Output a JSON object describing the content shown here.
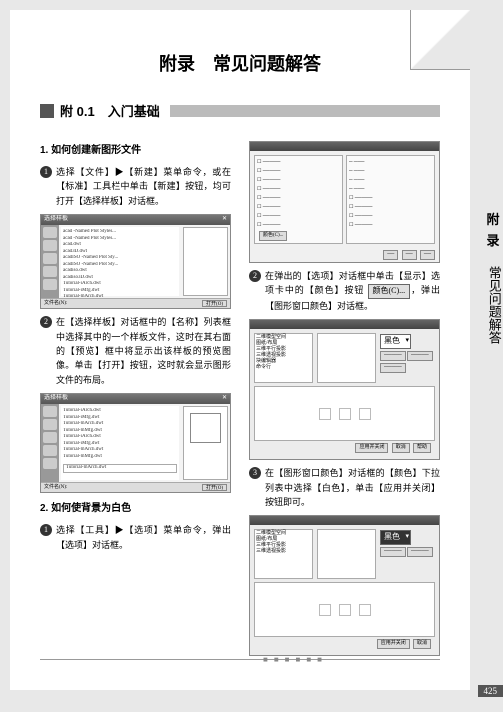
{
  "title": "附录　常见问题解答",
  "section": {
    "num": "附 0.1",
    "name": "入门基础"
  },
  "sidetab": {
    "l1": "附录",
    "l2": "常见问题解答"
  },
  "page_num": "425",
  "q1": {
    "head": "1. 如何创建新图形文件",
    "s1": "选择【文件】▶【新建】菜单命令，或在【标准】工具栏中单击【新建】按钮，均可打开【选择样板】对话框。",
    "s2": "在【选择样板】对话框中的【名称】列表框中选择其中的一个样板文件，这时在其右面的【预览】框中将显示出该样板的预览图像。单击【打开】按钮，这时就会显示图形文件的布局。"
  },
  "q2": {
    "head": "2. 如何使背景为白色",
    "s1": "选择【工具】▶【选项】菜单命令，弹出【选项】对话框。",
    "s2_a": "在弹出的【选项】对话框中单击【显示】选项卡中的【颜色】按钮",
    "s2_b": "，弹出【图形窗口颜色】对话框。",
    "s3": "在【图形窗口颜色】对话框的【颜色】下拉列表中选择【白色】，单击【应用并关闭】按钮即可。"
  },
  "btn_color": "颜色(C)...",
  "dd_black": "黑色",
  "filelist": [
    "acad -Named Plot Styles...",
    "acad -Named Plot Styles...",
    "acad.dwt",
    "acad3D.dwt",
    "acadISO -Named Plot Sty...",
    "acadISO -Named Plot Sty...",
    "acadiso.dwt",
    "acadiso3D.dwt",
    "Tutorial-iArch.dwt",
    "Tutorial-iMfg.dwt",
    "Tutorial-mArch.dwt"
  ],
  "filelist2": [
    "Tutorial-iArch.dwt",
    "Tutorial-iMfg.dwt",
    "Tutorial-mArch.dwt",
    "Tutorial-mMfg.dwt",
    "Tutorial-iArch.dwt",
    "Tutorial-iMfg.dwt",
    "Tutorial-mArch.dwt",
    "Tutorial-mMfg.dwt"
  ],
  "shot": {
    "title": "选择样板",
    "foot_l": "文件名(N):",
    "foot_r": "打开(O)",
    "sel": "Tutorial-mArch.dwt"
  },
  "cdlg": {
    "title": "图形窗口颜色",
    "items": [
      "二维模型空间",
      "图纸/布局",
      "三维平行投影",
      "三维透视投影",
      "块编辑器",
      "命令行"
    ],
    "btns": [
      "应用并关闭",
      "取消",
      "帮助"
    ]
  }
}
